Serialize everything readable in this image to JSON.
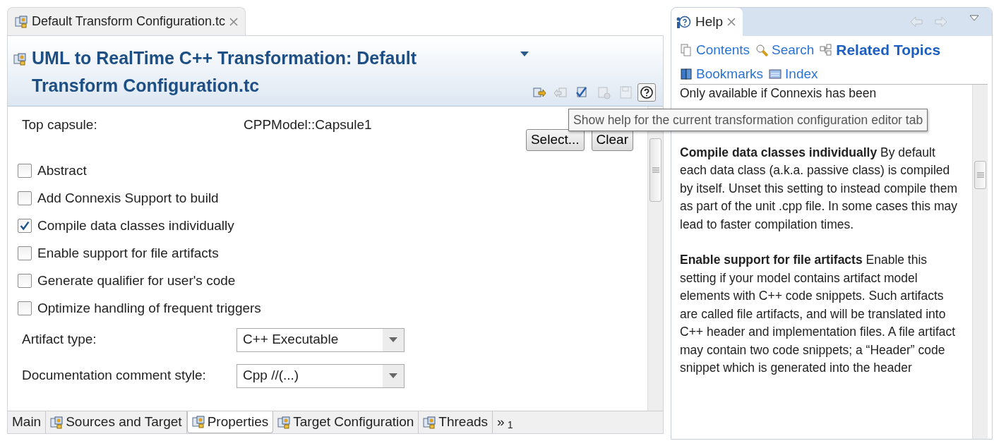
{
  "editor": {
    "tab_title": "Default Transform Configuration.tc",
    "title": "UML to RealTime C++ Transformation: Default Transform Configuration.tc",
    "toolbar": [
      {
        "kind": "export",
        "disabled": false,
        "pressed": false
      },
      {
        "kind": "import",
        "disabled": true,
        "pressed": false
      },
      {
        "kind": "validate",
        "disabled": false,
        "pressed": false
      },
      {
        "kind": "run",
        "disabled": true,
        "pressed": false
      },
      {
        "kind": "save",
        "disabled": true,
        "pressed": false
      },
      {
        "kind": "help",
        "disabled": false,
        "pressed": true
      }
    ],
    "tooltip": "Show help for the current transformation configuration editor tab",
    "top_capsule": {
      "label": "Top capsule:",
      "value": "CPPModel::Capsule1",
      "buttons": [
        "Select...",
        "Clear"
      ]
    },
    "options": [
      {
        "label": "Abstract",
        "checked": false
      },
      {
        "label": "Add Connexis Support to build",
        "checked": false
      },
      {
        "label": "Compile data classes individually",
        "checked": true
      },
      {
        "label": "Enable support for file artifacts",
        "checked": false
      },
      {
        "label": "Generate qualifier for user's code",
        "checked": false
      },
      {
        "label": "Optimize handling of frequent triggers",
        "checked": false
      }
    ],
    "selects": [
      {
        "label": "Artifact type:",
        "value": "C++ Executable"
      },
      {
        "label": "Documentation comment style:",
        "value": "Cpp //(...)"
      }
    ],
    "tabs": [
      {
        "label": "Main",
        "kind": "plain",
        "selected": false
      },
      {
        "label": "Sources and Target",
        "kind": "config",
        "selected": false
      },
      {
        "label": "Properties",
        "kind": "config",
        "selected": true
      },
      {
        "label": "Target Configuration",
        "kind": "config",
        "selected": false
      },
      {
        "label": "Threads",
        "kind": "config",
        "selected": false
      }
    ],
    "more_tabs": "»$_{1}$"
  },
  "help": {
    "tab_title": "Help",
    "nav": [
      {
        "kind": "back",
        "disabled": true
      },
      {
        "kind": "forward",
        "disabled": true
      }
    ],
    "links": [
      {
        "kind": "contents",
        "label": "Contents",
        "selected": false
      },
      {
        "kind": "search",
        "label": "Search",
        "selected": false
      },
      {
        "kind": "related",
        "label": "Related Topics",
        "selected": true
      },
      {
        "kind": "bookmarks",
        "label": "Bookmarks",
        "selected": false
      },
      {
        "kind": "index",
        "label": "Index",
        "selected": false
      }
    ],
    "paragraphs": [
      "Only available if Connexis has been",
      "**Compile data classes individually** By default each data class (a.k.a. passive class) is compiled by itself. Unset this setting to instead compile them as part of the unit .cpp file. In some cases this may lead to faster compilation times.",
      "**Enable support for file artifacts** Enable this setting if your model contains artifact model elements with C++ code snippets. Such artifacts are called file artifacts, and will be translated into C++ header and implementation files. A file artifact may contain two code snippets; a “Header” code snippet which is generated into the header"
    ]
  }
}
